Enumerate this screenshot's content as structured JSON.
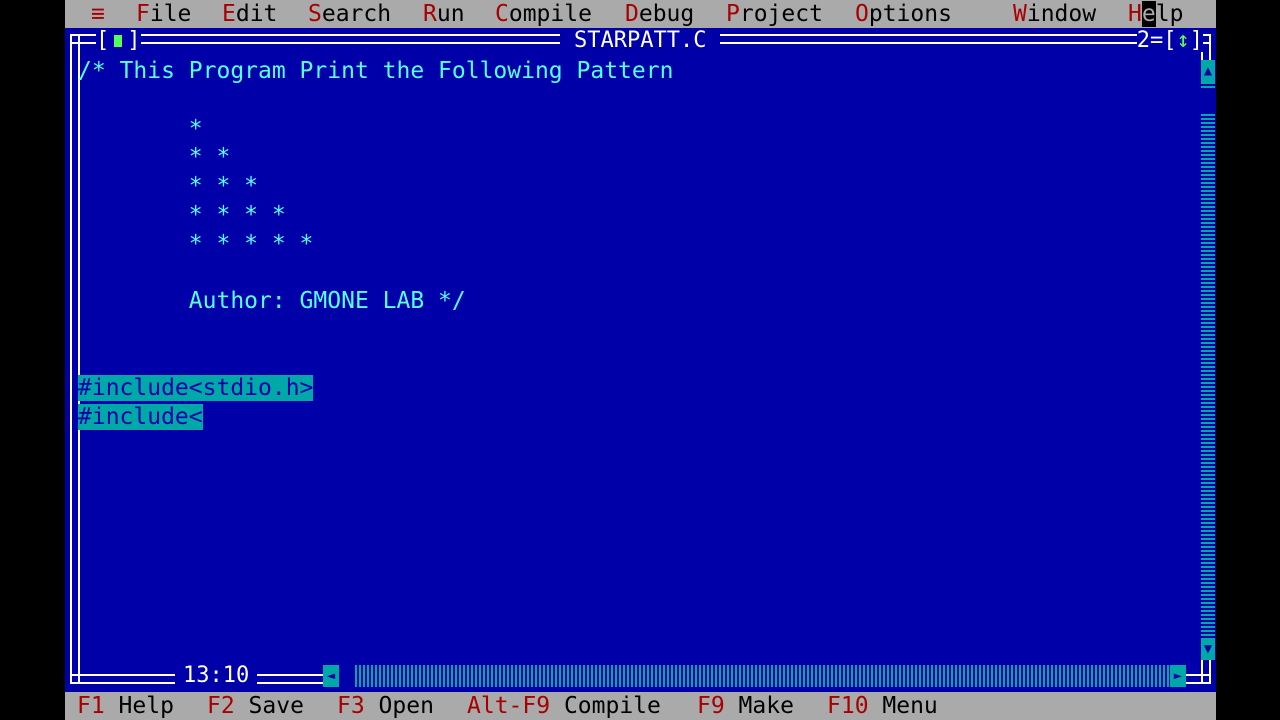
{
  "menubar": {
    "system_icon": "≡",
    "items": [
      {
        "hot": "F",
        "rest": "ile"
      },
      {
        "hot": "E",
        "rest": "dit"
      },
      {
        "hot": "S",
        "rest": "earch"
      },
      {
        "hot": "R",
        "rest": "un"
      },
      {
        "hot": "C",
        "rest": "ompile"
      },
      {
        "hot": "D",
        "rest": "ebug"
      },
      {
        "hot": "P",
        "rest": "roject"
      },
      {
        "hot": "O",
        "rest": "ptions"
      },
      {
        "hot": "W",
        "rest": "indow"
      }
    ],
    "help": {
      "hot": "H",
      "mid": "e",
      "rest": "lp"
    }
  },
  "window": {
    "close_left": "[",
    "close_right": "]",
    "title": "STARPATT.C",
    "number": "2",
    "zoom_left": "=[",
    "zoom_arrow": "↕",
    "zoom_right": "]",
    "cursor_position": "13:10"
  },
  "editor": {
    "lines": [
      "/* This Program Print the Following Pattern",
      "",
      "        *",
      "        * *",
      "        * * *",
      "        * * * *",
      "        * * * * *",
      "",
      "        Author: GMONE LAB */",
      "",
      "",
      "#include<stdio.h>",
      "#include<"
    ]
  },
  "statusbar": [
    {
      "key": "F1",
      "label": " Help"
    },
    {
      "key": "F2",
      "label": " Save"
    },
    {
      "key": "F3",
      "label": " Open"
    },
    {
      "key": "Alt-F9",
      "label": " Compile"
    },
    {
      "key": "F9",
      "label": " Make"
    },
    {
      "key": "F10",
      "label": " Menu"
    }
  ],
  "colors": {
    "editor_background": "#0000a8",
    "comment_text": "#55ffff",
    "selection": "#00a8a8",
    "menu_background": "#aaaaaa",
    "hotkey": "#a80000"
  }
}
